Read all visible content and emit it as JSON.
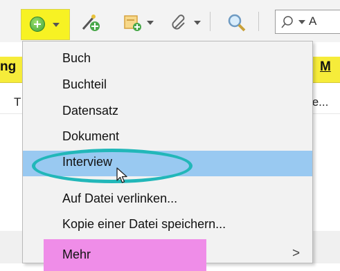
{
  "toolbar": {
    "add_icon": "add-circle-icon",
    "add_highlight_color": "#f7f223",
    "tools": [
      {
        "name": "wand-plus-icon"
      },
      {
        "name": "note-plus-icon"
      },
      {
        "name": "paperclip-icon"
      },
      {
        "name": "magnifier-icon"
      }
    ],
    "search_partial_text": "A"
  },
  "table": {
    "header_left_partial": "ng",
    "header_right_partial": "M",
    "row_left_partial": "T",
    "row_right_partial": "te..."
  },
  "menu": {
    "items": [
      {
        "label": "Buch"
      },
      {
        "label": "Buchteil"
      },
      {
        "label": "Datensatz"
      },
      {
        "label": "Dokument"
      },
      {
        "label": "Interview"
      },
      {
        "label": "Auf Datei verlinken..."
      },
      {
        "label": "Kopie einer Datei speichern..."
      },
      {
        "label": "Mehr"
      }
    ],
    "more_chevron": ">",
    "highlight_color": "#99c9f1",
    "more_highlight_color": "#ef8de8",
    "annotation_color": "#22b7b9"
  }
}
